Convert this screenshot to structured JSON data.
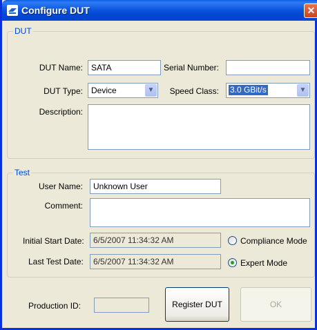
{
  "window": {
    "title": "Configure DUT",
    "title_icon": "sata-logo-icon",
    "close_label": "✕"
  },
  "dut_group": {
    "legend": "DUT",
    "dut_name": {
      "label": "DUT Name:",
      "value": "SATA"
    },
    "serial_number": {
      "label": "Serial Number:",
      "value": ""
    },
    "dut_type": {
      "label": "DUT Type:",
      "value": "Device"
    },
    "speed_class": {
      "label": "Speed Class:",
      "value": "3.0 GBit/s"
    },
    "description": {
      "label": "Description:",
      "value": ""
    }
  },
  "test_group": {
    "legend": "Test",
    "user_name": {
      "label": "User Name:",
      "value": "Unknown User"
    },
    "comment": {
      "label": "Comment:",
      "value": ""
    },
    "initial_start_date": {
      "label": "Initial Start Date:",
      "value": "6/5/2007 11:34:32 AM"
    },
    "last_test_date": {
      "label": "Last Test Date:",
      "value": "6/5/2007 11:34:32 AM"
    },
    "compliance_mode": {
      "label": "Compliance Mode",
      "selected": false
    },
    "expert_mode": {
      "label": "Expert Mode",
      "selected": true
    }
  },
  "footer": {
    "production_id": {
      "label": "Production ID:",
      "value": ""
    },
    "register_button": "Register DUT",
    "ok_button": "OK"
  },
  "colors": {
    "titlebar": "#0a5ee8",
    "legend_text": "#0046d5",
    "dialog_bg": "#ece9d8",
    "selection": "#316ac5"
  }
}
